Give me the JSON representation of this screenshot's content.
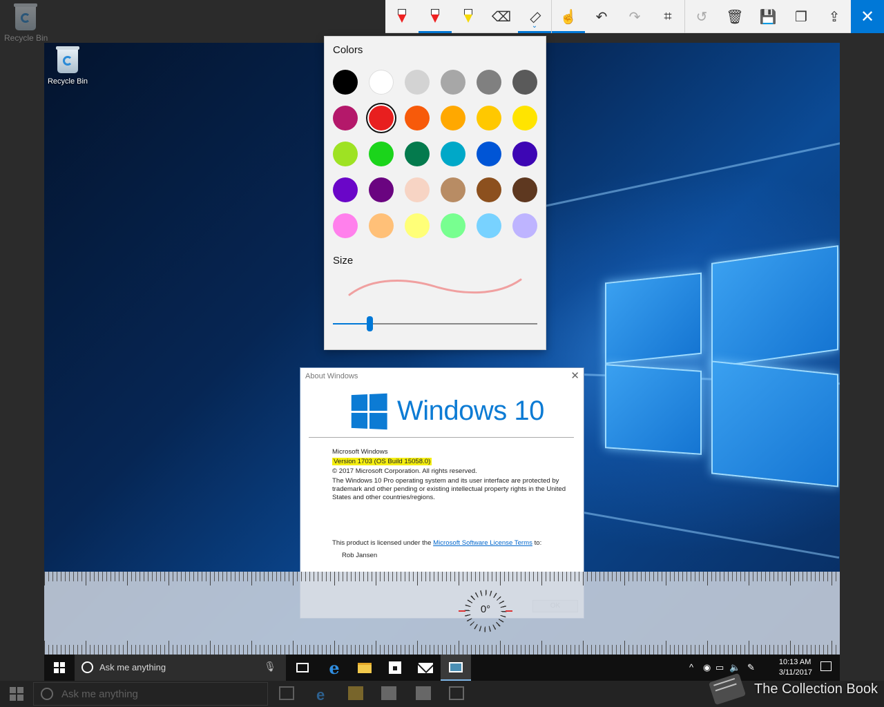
{
  "outer_desktop": {
    "recycle_bin_label": "Recycle Bin",
    "taskbar": {
      "search_placeholder": "Ask me anything",
      "clock_time": "10:13 AM",
      "clock_date": "3/11/2017"
    }
  },
  "ink_toolbar": {
    "tools": [
      {
        "name": "ballpoint-pen",
        "icon": "pen-icon"
      },
      {
        "name": "pencil",
        "icon": "pencil-icon"
      },
      {
        "name": "highlighter",
        "icon": "highlighter-icon"
      },
      {
        "name": "eraser",
        "icon": "eraser-icon"
      },
      {
        "name": "ruler",
        "icon": "ruler-icon"
      },
      {
        "name": "touch-writing",
        "icon": "touch-writing-icon"
      },
      {
        "name": "undo",
        "icon": "undo-icon"
      },
      {
        "name": "redo",
        "icon": "redo-icon"
      },
      {
        "name": "crop",
        "icon": "crop-icon"
      },
      {
        "name": "replay",
        "icon": "replay-icon"
      },
      {
        "name": "delete",
        "icon": "trash-icon"
      },
      {
        "name": "save",
        "icon": "save-icon"
      },
      {
        "name": "copy",
        "icon": "copy-icon"
      },
      {
        "name": "share",
        "icon": "share-icon"
      },
      {
        "name": "close",
        "icon": "close-icon"
      }
    ],
    "accent_color": "#0078d7"
  },
  "color_flyout": {
    "colors_heading": "Colors",
    "size_heading": "Size",
    "selected_color": "#e81f1f",
    "size_level": 0.18,
    "palette": [
      "#000000",
      "#ffffff",
      "#d3d3d3",
      "#a7a7a7",
      "#808080",
      "#5a5a5a",
      "#b4186a",
      "#e81f1f",
      "#f75a0a",
      "#ffa800",
      "#ffc800",
      "#ffe400",
      "#9ee223",
      "#1bd41b",
      "#047a4d",
      "#00a8c8",
      "#0055d6",
      "#3d06b4",
      "#6a06c8",
      "#6a0480",
      "#f7d4c4",
      "#b88c64",
      "#8c501e",
      "#5e3820",
      "#ff80ec",
      "#ffc078",
      "#ffff78",
      "#78ff90",
      "#78d2ff",
      "#beb4ff"
    ],
    "stroke_preview_color": "#f0a0a0"
  },
  "screenshot": {
    "recycle_bin_label": "Recycle Bin",
    "about_dialog": {
      "title": "About Windows",
      "brand": "Windows 10",
      "line_product": "Microsoft Windows",
      "line_version": "Version 1703 (OS Build 15058.0)",
      "line_copyright": "© 2017 Microsoft Corporation. All rights reserved.",
      "line_desc": "The Windows 10 Pro operating system and its user interface are protected by trademark and other pending or existing intellectual property rights in the United States and other countries/regions.",
      "license_prefix": "This product is licensed under the ",
      "license_link": "Microsoft Software License Terms",
      "license_suffix": " to:",
      "licensee": "Rob Jansen",
      "ok_label": "OK"
    },
    "ruler": {
      "angle_label": "0°"
    },
    "taskbar": {
      "search_placeholder": "Ask me anything",
      "clock_time": "10:13 AM",
      "clock_date": "3/11/2017"
    }
  },
  "watermark": {
    "text": "The Collection Book"
  }
}
